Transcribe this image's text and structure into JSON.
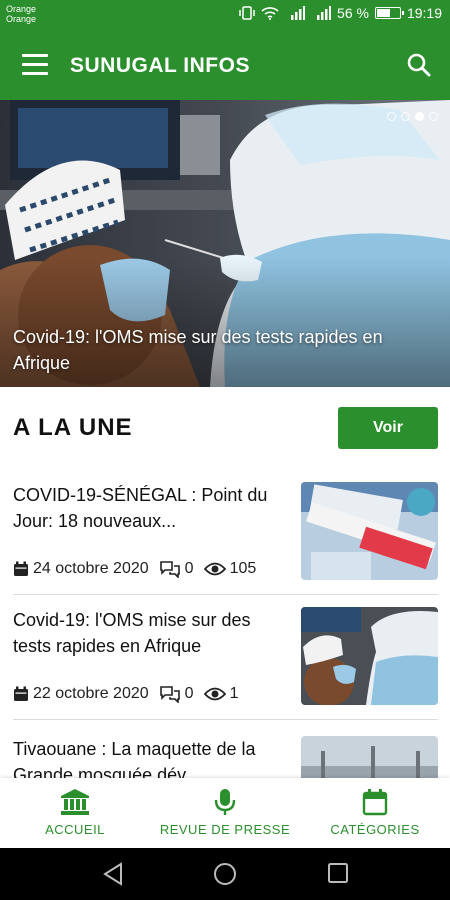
{
  "status_bar": {
    "carrier1": "Orange",
    "carrier2": "Orange",
    "battery_text": "56 %",
    "battery_level": 0.56,
    "time": "19:19"
  },
  "app_bar": {
    "title": "SUNUGAL INFOS",
    "color": "#2a8f2c"
  },
  "hero": {
    "caption": "Covid-19: l'OMS mise sur des tests rapides en Afrique",
    "slide_count": 4,
    "active_slide": 2
  },
  "section": {
    "title": "A LA UNE",
    "button": "Voir"
  },
  "articles": [
    {
      "title": "COVID-19-SÉNÉGAL : Point du Jour: 18 nouveaux...",
      "date": "24 octobre 2020",
      "comments": "0",
      "views": "105"
    },
    {
      "title": "Covid-19: l'OMS mise sur des tests rapides en Afrique",
      "date": "22 octobre 2020",
      "comments": "0",
      "views": "1"
    },
    {
      "title": "Tivaouane : La maquette de la Grande mosquée dév",
      "date": "",
      "comments": "",
      "views": ""
    }
  ],
  "bottom_nav": [
    {
      "label": "ACCUEIL",
      "icon": "bank-icon"
    },
    {
      "label": "REVUE DE PRESSE",
      "icon": "microphone-icon"
    },
    {
      "label": "CATÉGORIES",
      "icon": "calendar-icon"
    }
  ]
}
